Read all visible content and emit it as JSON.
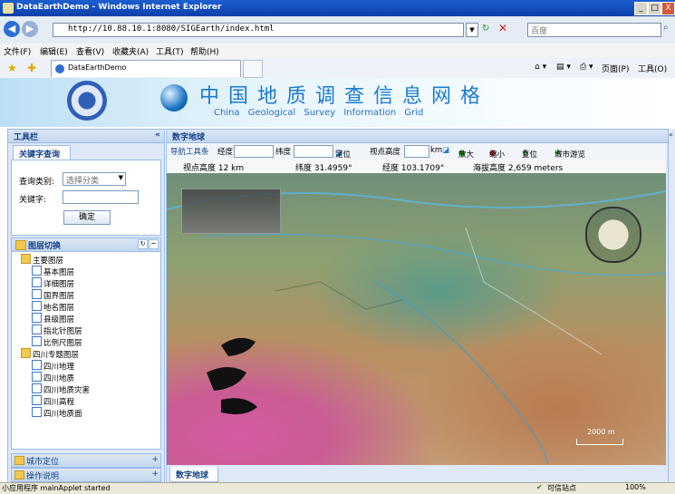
{
  "window": {
    "title": "DataEarthDemo - Windows Internet Explorer",
    "min": "_",
    "max": "□",
    "close": "X"
  },
  "addressbar": {
    "url": "http://10.88.10.1:8080/SIGEarth/index.html",
    "search_placeholder": "百度"
  },
  "menu": [
    "文件(F)",
    "编辑(E)",
    "查看(V)",
    "收藏夹(A)",
    "工具(T)",
    "帮助(H)"
  ],
  "tab": {
    "title": "DataEarthDemo"
  },
  "cmdbar": {
    "page": "页面(P)",
    "tools": "工具(O)"
  },
  "header": {
    "title_cn": "中国地质调查信息网格",
    "title_en": "China Geological Survey Information Grid"
  },
  "toolbox": {
    "title": "工具栏",
    "collapse": "«",
    "keyword_tab": "关键字查询",
    "category_label": "查询类别:",
    "category_value": "选择分类",
    "keyword_label": "关键字:",
    "confirm": "确定"
  },
  "layers": {
    "title": "图层切换",
    "groups": [
      {
        "name": "主要图层",
        "items": [
          "基本图层",
          "详细图层",
          "国界图层",
          "地名图层",
          "县级图层",
          "指北针图层",
          "比例尺图层"
        ]
      },
      {
        "name": "四川专题图层",
        "items": [
          "四川地理",
          "四川地质",
          "四川地质灾害",
          "四川高程",
          "四川地质面"
        ]
      }
    ]
  },
  "bottom_panels": [
    {
      "label": "城市定位"
    },
    {
      "label": "操作说明"
    }
  ],
  "map": {
    "panel_title": "数字地球",
    "toolbar": {
      "nav_label": "导航工具条",
      "lon_label": "经度",
      "lat_label": "纬度",
      "locate": "定位",
      "view_height": "视点高度",
      "unit": "km",
      "zoom_in": "放大",
      "zoom_out": "缩小",
      "reset": "复位",
      "city_tour": "城市游览"
    },
    "info": {
      "view_height": "视点高度    12 km",
      "lat": "纬度 31.4959°",
      "lon": "经度 103.1709°",
      "altitude": "海拔高度  2,659 meters"
    },
    "scale_label": "2000 m",
    "bottom_tab": "数字地球"
  },
  "statusbar": {
    "applet": "小应用程序 mainApplet started",
    "zone": "可信站点",
    "zoom": "100%"
  }
}
